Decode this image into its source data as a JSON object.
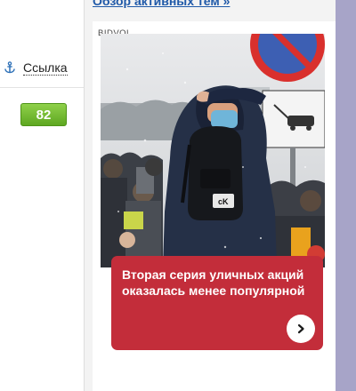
{
  "header": {
    "active_topics_link": "Обзор активных тем »"
  },
  "sidebar": {
    "link_label": "Ссылка",
    "link_icon": "anchor-icon",
    "count_badge": "82"
  },
  "ad": {
    "label": "BIDVOL",
    "headline": "Вторая серия уличных акций оказалась менее популярной",
    "image_alt": "person-in-hood-and-mask-with-backpack-in-crowd",
    "arrow_icon": "chevron-right-icon"
  },
  "colors": {
    "badge_green": "#6cb82d",
    "headline_red": "#c32d3a",
    "link_blue": "#1f59a8",
    "side_strip": "#a7a4c8"
  }
}
